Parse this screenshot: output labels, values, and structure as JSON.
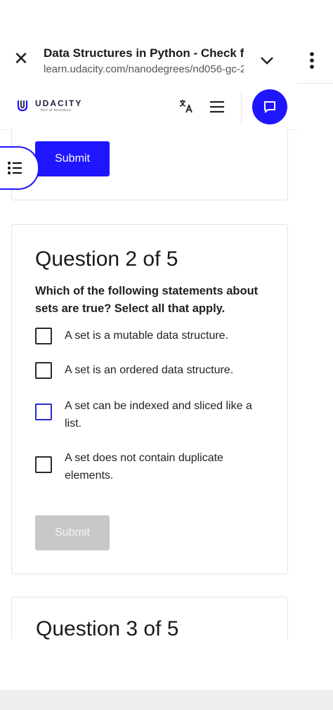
{
  "browser": {
    "title": "Data Structures in Python - Check f",
    "url": "learn.udacity.com/nanodegrees/nd056-gc-2"
  },
  "header": {
    "logo_text": "UDACITY",
    "logo_sub": "Part of Accenture"
  },
  "top_card": {
    "submit_label": "Submit"
  },
  "question": {
    "heading": "Question 2 of 5",
    "text": "Which of the following statements about sets are true? Select all that apply.",
    "options": [
      {
        "label": "A set is a mutable data structure."
      },
      {
        "label": "A set is an ordered data structure."
      },
      {
        "label": "A set can be indexed and sliced like a list."
      },
      {
        "label": "A set does not contain duplicate elements."
      }
    ],
    "submit_label": "Submit"
  },
  "next_question": {
    "heading": "Question 3 of 5"
  },
  "colors": {
    "accent": "#2015ff",
    "disabled": "#c8c8c8"
  }
}
